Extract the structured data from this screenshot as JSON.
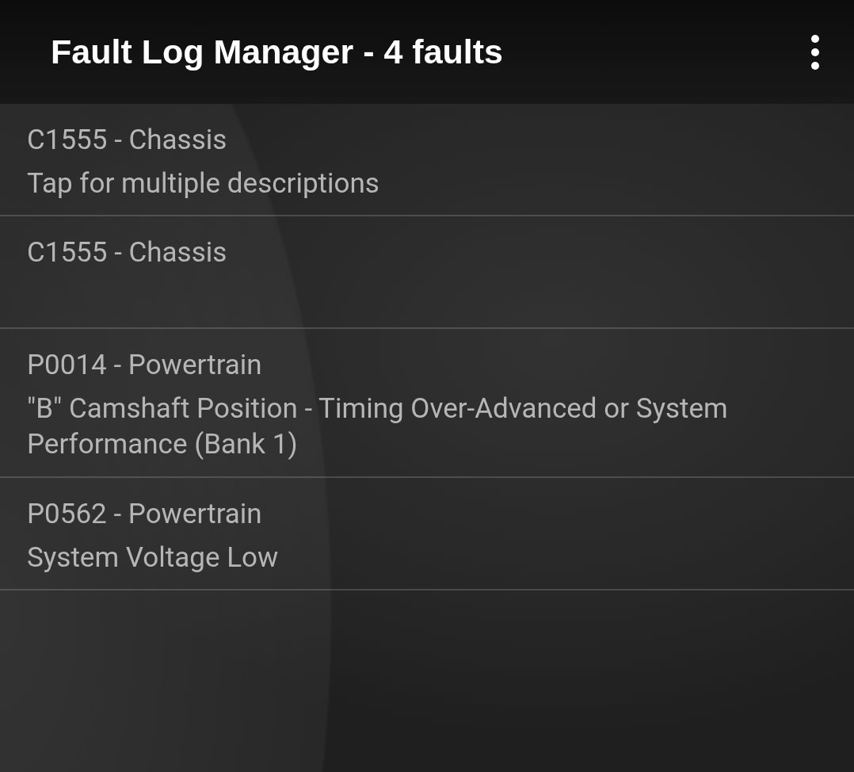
{
  "app_bar": {
    "title": "Fault Log Manager - 4 faults"
  },
  "faults": [
    {
      "title": "C1555 - Chassis",
      "description": "Tap for multiple descriptions"
    },
    {
      "title": "C1555 - Chassis"
    },
    {
      "title": "P0014 - Powertrain",
      "description": "\"B\" Camshaft Position - Timing Over-Advanced or System Performance (Bank 1)"
    },
    {
      "title": "P0562 - Powertrain",
      "description": "System Voltage Low"
    }
  ]
}
